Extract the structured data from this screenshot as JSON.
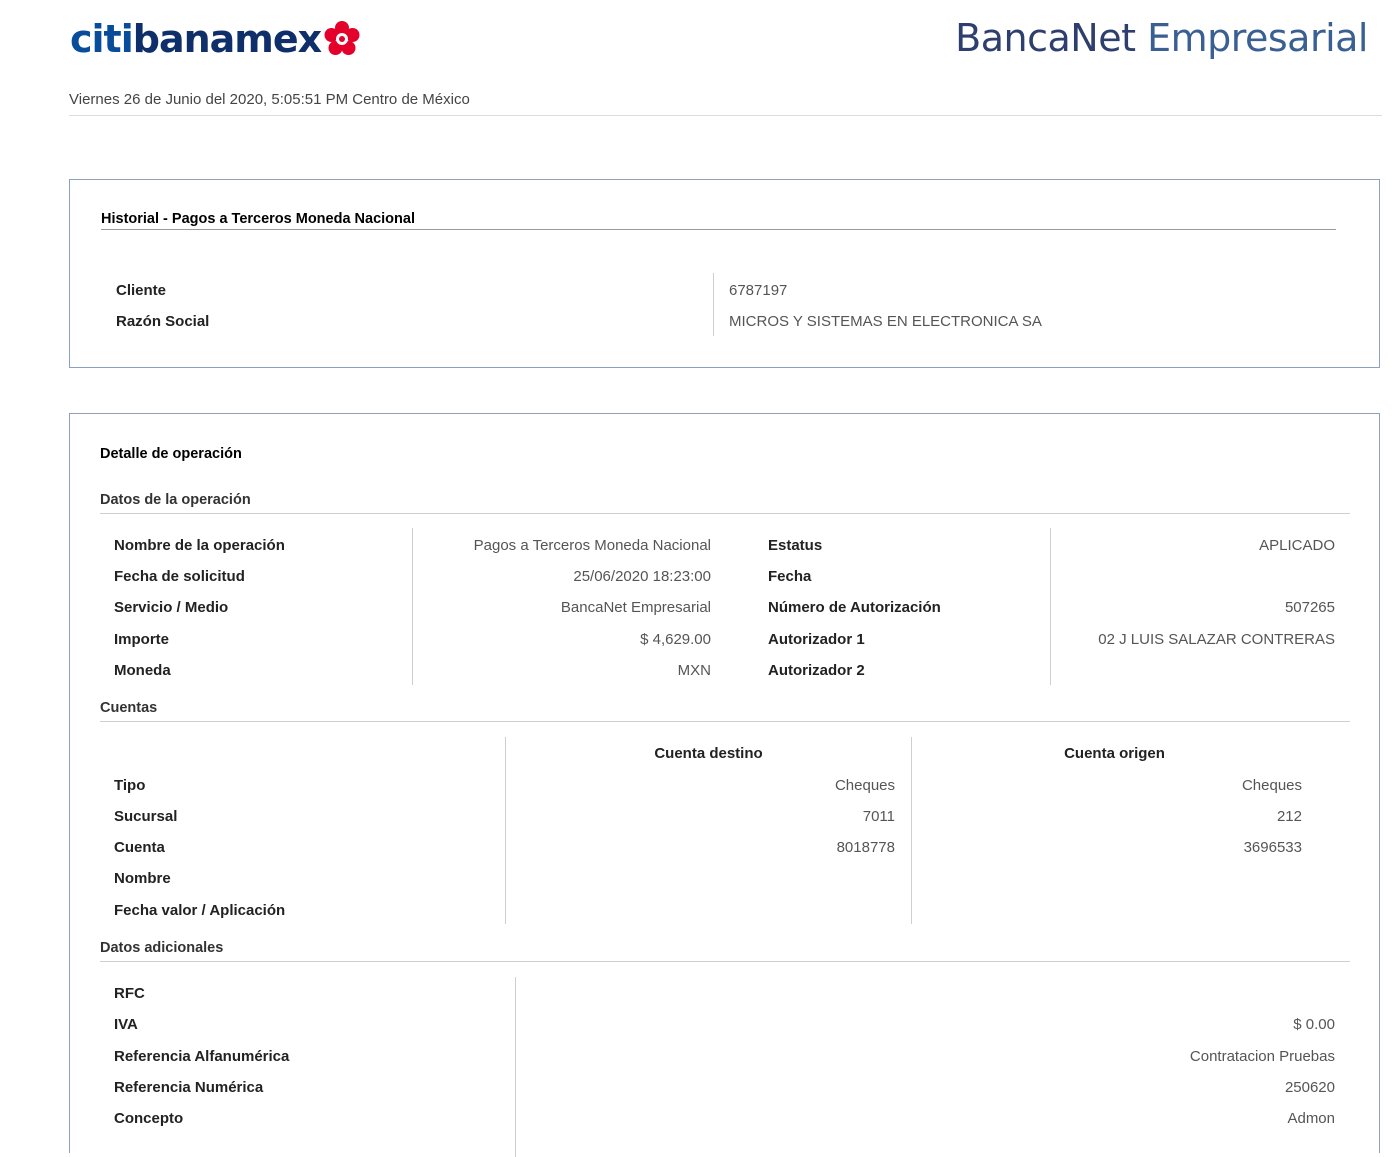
{
  "header": {
    "logo_left_part1": "citi",
    "logo_left_part2": "banamex",
    "logo_right_part1": "BancaNet",
    "logo_right_part2": " Empresarial",
    "datetime": "Viernes 26 de Junio del 2020, 5:05:51 PM Centro de México"
  },
  "colors": {
    "brand_blue": "#0a4c9c",
    "brand_navy": "#0f2f6b",
    "flower_red": "#e4002b",
    "box_border": "#8ea0bf"
  },
  "historial": {
    "title": "Historial - Pagos a Terceros Moneda Nacional",
    "cliente_label": "Cliente",
    "cliente_value": "6787197",
    "razon_label": "Razón Social",
    "razon_value": "MICROS Y SISTEMAS EN ELECTRONICA SA"
  },
  "detalle": {
    "title": "Detalle de operación",
    "datos_operacion": {
      "title": "Datos de la operación",
      "left": [
        {
          "label": "Nombre de la operación",
          "value": "Pagos a Terceros Moneda Nacional"
        },
        {
          "label": "Fecha de solicitud",
          "value": "25/06/2020 18:23:00"
        },
        {
          "label": "Servicio / Medio",
          "value": "BancaNet Empresarial"
        },
        {
          "label": "Importe",
          "value": "$ 4,629.00"
        },
        {
          "label": "Moneda",
          "value": "MXN"
        }
      ],
      "right": [
        {
          "label": "Estatus",
          "value": "APLICADO"
        },
        {
          "label": "Fecha",
          "value": ""
        },
        {
          "label": "Número de Autorización",
          "value": "507265"
        },
        {
          "label": "Autorizador 1",
          "value": "02 J LUIS SALAZAR CONTRERAS"
        },
        {
          "label": "Autorizador 2",
          "value": ""
        }
      ]
    },
    "cuentas": {
      "title": "Cuentas",
      "col_destino": "Cuenta destino",
      "col_origen": "Cuenta origen",
      "rows": [
        {
          "label": "Tipo",
          "destino": "Cheques",
          "origen": "Cheques"
        },
        {
          "label": "Sucursal",
          "destino": "7011",
          "origen": "212"
        },
        {
          "label": "Cuenta",
          "destino": "8018778",
          "origen": "3696533"
        },
        {
          "label": "Nombre",
          "destino": "",
          "origen": ""
        },
        {
          "label": "Fecha valor / Aplicación",
          "destino": "",
          "origen": ""
        }
      ]
    },
    "adicionales": {
      "title": "Datos adicionales",
      "rows": [
        {
          "label": "RFC",
          "value": ""
        },
        {
          "label": "IVA",
          "value": "$ 0.00"
        },
        {
          "label": "Referencia Alfanumérica",
          "value": "Contratacion Pruebas"
        },
        {
          "label": "Referencia Numérica",
          "value": "250620"
        },
        {
          "label": "Concepto",
          "value": "Admon"
        }
      ]
    }
  }
}
